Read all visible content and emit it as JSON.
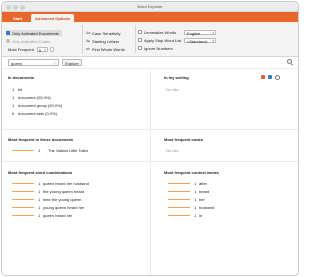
{
  "window": {
    "title": "Word Explorer"
  },
  "tabs": [
    {
      "label": "Start",
      "active": false
    },
    {
      "label": "Advanced Options",
      "active": true
    }
  ],
  "ribbon": {
    "only_activated_documents": "Only Activated Documents",
    "only_activated_codes": "Only Activated Codes",
    "most_frequent": {
      "label": "Most Frequent",
      "value": "5"
    },
    "case_sensitivity": "Case Sensitivity",
    "starting_letters": "Starting Letters",
    "find_whole_words": "Find Whole Words",
    "lemmatize_words": {
      "label": "Lemmatize Words",
      "value": "English"
    },
    "apply_stop_word_list": {
      "label": "Apply Stop Word List",
      "value": "<Standard>"
    },
    "ignore_numbers": "Ignore Numbers"
  },
  "search": {
    "value": "queen",
    "explore_label": "Explore"
  },
  "panels": {
    "in_documents": {
      "title": "In documents",
      "rows": [
        {
          "count": "1",
          "text": "hit"
        },
        {
          "count": "1",
          "text": "document (25,0%)"
        },
        {
          "count": "1",
          "text": "document group (50,0%)"
        },
        {
          "count": "0",
          "text": "document sets (0,0%)"
        }
      ]
    },
    "in_my_writing": {
      "title": "In my writing",
      "empty": "No hits"
    },
    "most_frequent_documents": {
      "title": "Most frequent in these documents",
      "rows": [
        {
          "count": "1",
          "text": "The Valiant Little Tailor"
        }
      ]
    },
    "most_frequent_codes": {
      "title": "Most frequent codes",
      "empty": "No hits"
    },
    "word_combinations": {
      "title": "Most frequent word combinations",
      "rows": [
        {
          "count": "1",
          "text": "queen heard her husband"
        },
        {
          "count": "1",
          "text": "the young queen heard"
        },
        {
          "count": "1",
          "text": "time the young queen"
        },
        {
          "count": "1",
          "text": "young queen heard her"
        },
        {
          "count": "1",
          "text": "queen heard her"
        }
      ]
    },
    "context_words": {
      "title": "Most frequent context words",
      "rows": [
        {
          "count": "1",
          "text": "after"
        },
        {
          "count": "1",
          "text": "heard"
        },
        {
          "count": "1",
          "text": "her"
        },
        {
          "count": "1",
          "text": "husband"
        },
        {
          "count": "1",
          "text": "in"
        }
      ]
    }
  },
  "colors": {
    "accent": "#e8682c",
    "bar": "#f0a55a"
  }
}
